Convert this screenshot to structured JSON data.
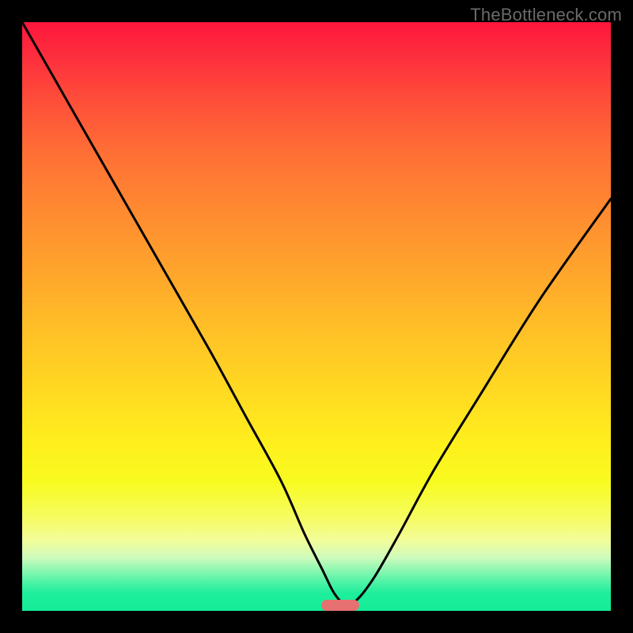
{
  "watermark": "TheBottleneck.com",
  "chart_data": {
    "type": "line",
    "title": "",
    "xlabel": "",
    "ylabel": "",
    "xlim": [
      0,
      100
    ],
    "ylim": [
      0,
      100
    ],
    "grid": false,
    "legend": false,
    "series": [
      {
        "name": "bottleneck-curve",
        "x": [
          0,
          8,
          16,
          24,
          32,
          38,
          44,
          48,
          51,
          53,
          55,
          57,
          60,
          64,
          70,
          78,
          88,
          100
        ],
        "values": [
          100,
          86,
          72,
          58,
          44,
          33,
          22,
          13,
          7,
          3,
          1,
          2,
          6,
          13,
          24,
          37,
          53,
          70
        ]
      }
    ],
    "marker": {
      "x": 54,
      "y": 1,
      "color": "#e77070"
    },
    "background_gradient": {
      "top": "#fe163c",
      "mid": "#ffe41f",
      "bottom": "#15ed98"
    }
  }
}
